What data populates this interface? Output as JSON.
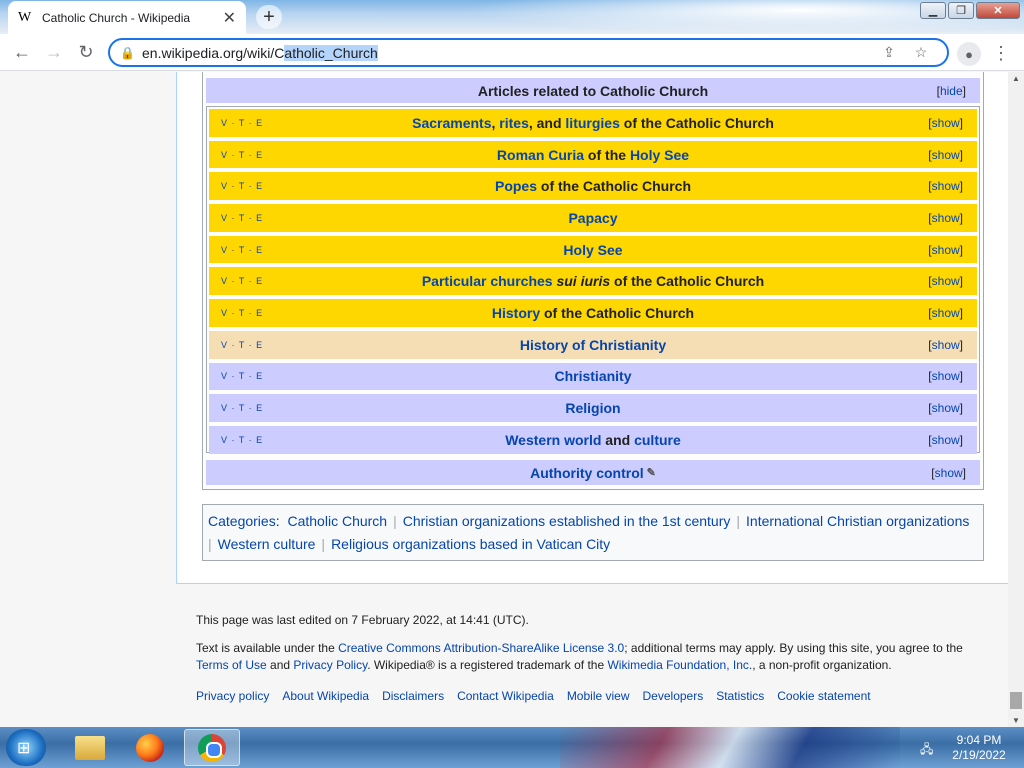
{
  "browser": {
    "tab_title": "Catholic Church - Wikipedia",
    "tab_favicon": "W",
    "url_prefix": "en.wikipedia.org/wiki/",
    "url_plain": "C",
    "url_selected": "atholic_Church"
  },
  "navbox": {
    "title": "Articles related to Catholic Church",
    "hide_label": "hide",
    "vte": "V · T · E",
    "show_label": "show",
    "rows": [
      {
        "parts": [
          "Sacraments",
          ", ",
          "rites",
          ", and ",
          "liturgies",
          " of the Catholic Church"
        ]
      },
      {
        "parts": [
          "Roman Curia",
          " of the ",
          "Holy See"
        ]
      },
      {
        "parts": [
          "Popes",
          " of the Catholic Church"
        ]
      },
      {
        "parts": [
          "Papacy"
        ]
      },
      {
        "parts": [
          "Holy See"
        ]
      },
      {
        "parts": [
          "Particular churches ",
          "sui iuris",
          " of the Catholic Church"
        ]
      },
      {
        "parts": [
          "History",
          " of the Catholic Church"
        ]
      },
      {
        "parts": [
          "History of Christianity"
        ]
      },
      {
        "parts": [
          "Christianity"
        ]
      },
      {
        "parts": [
          "Religion"
        ]
      },
      {
        "parts": [
          "Western world",
          " and ",
          "culture"
        ]
      }
    ],
    "authority": "Authority control"
  },
  "categories": {
    "label": "Categories",
    "items": [
      "Catholic Church",
      "Christian organizations established in the 1st century",
      "International Christian organizations",
      "Western culture",
      "Religious organizations based in Vatican City"
    ]
  },
  "footer": {
    "last_edited": "This page was last edited on 7 February 2022, at 14:41 (UTC).",
    "license_1": "Text is available under the ",
    "license_link": "Creative Commons Attribution-ShareAlike License 3.0",
    "license_2": "; additional terms may apply. By using this site, you agree to the ",
    "terms_link": "Terms of Use",
    "and": " and ",
    "privacy_link": "Privacy Policy",
    "license_3": ". Wikipedia® is a registered trademark of the ",
    "wmf_link": "Wikimedia Foundation, Inc.",
    "license_4": ", a non-profit organization.",
    "links": [
      "Privacy policy",
      "About Wikipedia",
      "Disclaimers",
      "Contact Wikipedia",
      "Mobile view",
      "Developers",
      "Statistics",
      "Cookie statement"
    ]
  },
  "taskbar": {
    "time": "9:04 PM",
    "date": "2/19/2022"
  },
  "colors": {
    "gold": "#ffd700",
    "tan": "#f5deb3",
    "lavender": "#ccccff",
    "link": "#0645ad"
  }
}
